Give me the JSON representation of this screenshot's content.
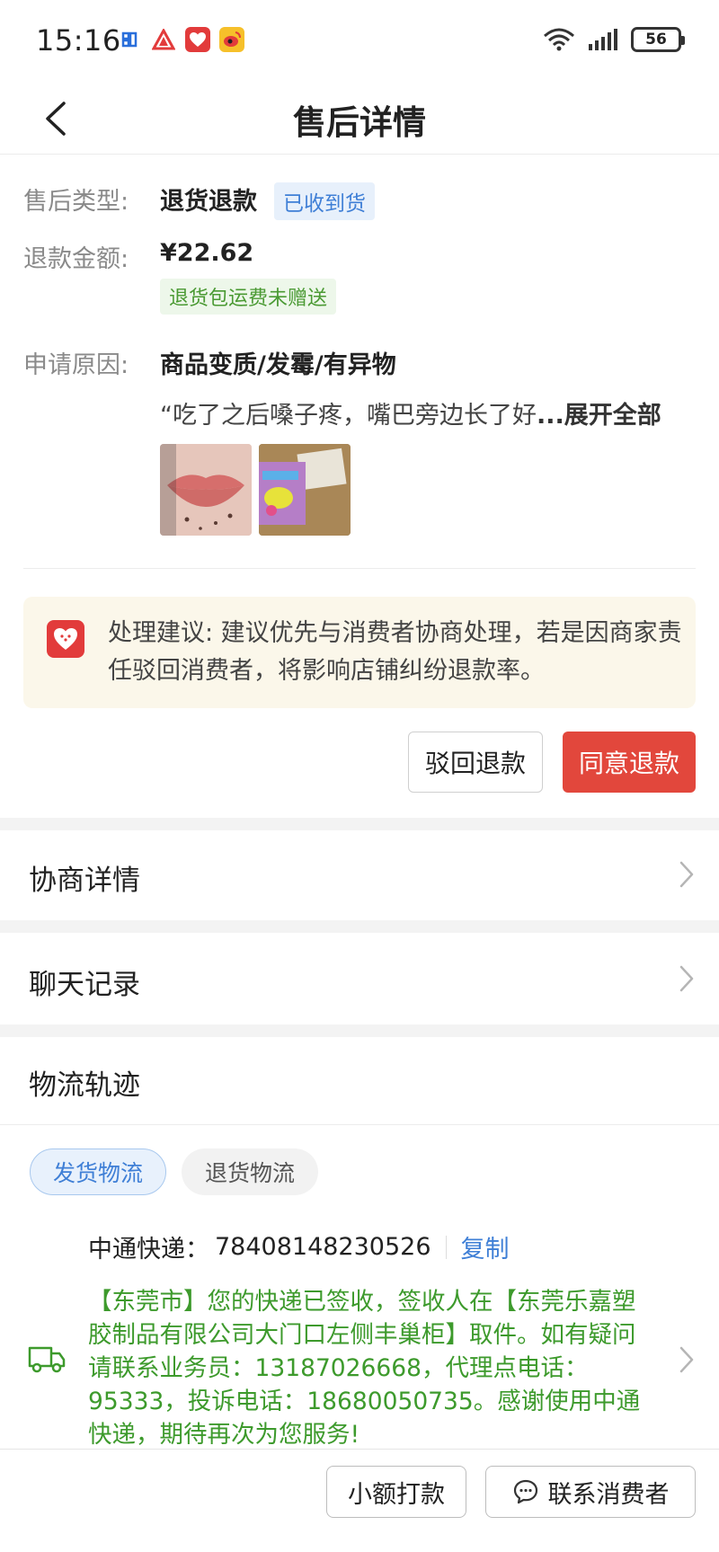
{
  "status_bar": {
    "time": "15:16",
    "battery": "56",
    "app_icons": [
      "app-icon-blue",
      "app-icon-red-triangle",
      "pinduoduo-icon",
      "weibo-icon"
    ]
  },
  "nav": {
    "title": "售后详情"
  },
  "detail": {
    "type_label": "售后类型:",
    "type_value": "退货退款",
    "type_badge": "已收到货",
    "amount_label": "退款金额:",
    "amount_value": "¥22.62",
    "amount_badge": "退货包运费未赠送",
    "reason_label": "申请原因:",
    "reason_value": "商品变质/发霉/有异物",
    "reason_text": "“吃了之后嗓子疼，嘴巴旁边长了好",
    "reason_expand": "...展开全部"
  },
  "suggestion": {
    "text": "处理建议: 建议优先与消费者协商处理，若是因商家责任驳回消费者，将影响店铺纠纷退款率。"
  },
  "actions": {
    "reject": "驳回退款",
    "agree": "同意退款"
  },
  "menu": {
    "negotiation": "协商详情",
    "chat": "聊天记录"
  },
  "logistics": {
    "title": "物流轨迹",
    "tab_ship": "发货物流",
    "tab_return": "退货物流",
    "courier_label": "中通快递：",
    "tracking_no": "78408148230526",
    "copy": "复制",
    "latest": "【东莞市】您的快递已签收，签收人在【东莞乐嘉塑胶制品有限公司大门口左侧丰巢柜】取件。如有疑问请联系业务员：13187026668，代理点电话：95333，投诉电话：18680050735。感谢使用中通快递，期待再次为您服务!"
  },
  "bottom": {
    "small_pay": "小额打款",
    "contact": "联系消费者"
  },
  "colors": {
    "primary_red": "#e2473c",
    "link_blue": "#3f7fd6",
    "track_green": "#3d9a2c"
  }
}
